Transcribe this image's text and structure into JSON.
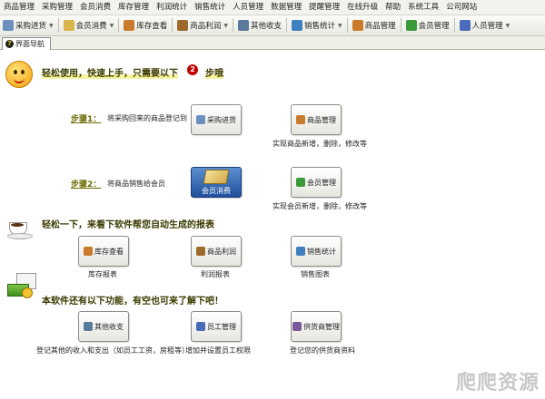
{
  "menubar": [
    "商品管理",
    "采购管理",
    "会员消费",
    "库存管理",
    "利润统计",
    "销售统计",
    "人员管理",
    "数据管理",
    "提醒管理",
    "在线升级",
    "帮助",
    "系统工具",
    "公司网站"
  ],
  "toolbar": [
    {
      "label": "采购进货",
      "icon": "purchase-icon",
      "color": "#6b8fbf",
      "dropdown": true
    },
    {
      "label": "会员消费",
      "icon": "member-card-icon",
      "color": "#d9b54a",
      "dropdown": true
    },
    {
      "label": "库存查看",
      "icon": "box-icon",
      "color": "#c97a2b",
      "dropdown": false
    },
    {
      "label": "商品利润",
      "icon": "money-bag-icon",
      "color": "#9c6a2a",
      "dropdown": true
    },
    {
      "label": "其他收支",
      "icon": "notepad-icon",
      "color": "#5a7a9c",
      "dropdown": false
    },
    {
      "label": "销售统计",
      "icon": "chart-icon",
      "color": "#3f7fbf",
      "dropdown": true
    },
    {
      "label": "商品管理",
      "icon": "box-icon",
      "color": "#c97a2b",
      "dropdown": false
    },
    {
      "label": "会员管理",
      "icon": "users-icon",
      "color": "#3a9a3a",
      "dropdown": false
    },
    {
      "label": "人员管理",
      "icon": "person-icon",
      "color": "#4a6aba",
      "dropdown": true
    }
  ],
  "tab": {
    "label": "界面导航"
  },
  "headline1": {
    "text": "轻松使用，快速上手，只需要以下",
    "num": "2",
    "tail": "步哦"
  },
  "step1": {
    "link": "步骤1：",
    "desc": "将采购回来的商品登记到",
    "button": "采购进货"
  },
  "goods": {
    "button": "商品管理",
    "caption": "实现商品新增，删除，修改等"
  },
  "step2": {
    "link": "步骤2：",
    "desc": "将商品销售给会员",
    "button": "会员消费"
  },
  "member": {
    "button": "会员管理",
    "caption": "实现会员新增，删除，修改等"
  },
  "headline2": "轻松一下，来看下软件帮您自动生成的报表",
  "reports": [
    {
      "button": "库存查看",
      "caption": "库存报表",
      "icon": "box-icon",
      "color": "#c97a2b"
    },
    {
      "button": "商品利润",
      "caption": "利润报表",
      "icon": "money-bag-icon",
      "color": "#9c6a2a"
    },
    {
      "button": "销售统计",
      "caption": "销售图表",
      "icon": "chart-icon",
      "color": "#3f7fbf"
    }
  ],
  "headline3": "本软件还有以下功能，有空也可来了解下吧！",
  "features": [
    {
      "button": "其他收支",
      "caption": "登记其他的收入和支出（如员工工资，房租等）",
      "icon": "notepad-icon",
      "color": "#5a7a9c"
    },
    {
      "button": "员工管理",
      "caption": "增加并设置员工权限",
      "icon": "person-icon",
      "color": "#4a6aba"
    },
    {
      "button": "供货商管理",
      "caption": "登记您的供货商资料",
      "icon": "supplier-icon",
      "color": "#7a5a9a"
    }
  ],
  "watermark": "爬爬资源"
}
